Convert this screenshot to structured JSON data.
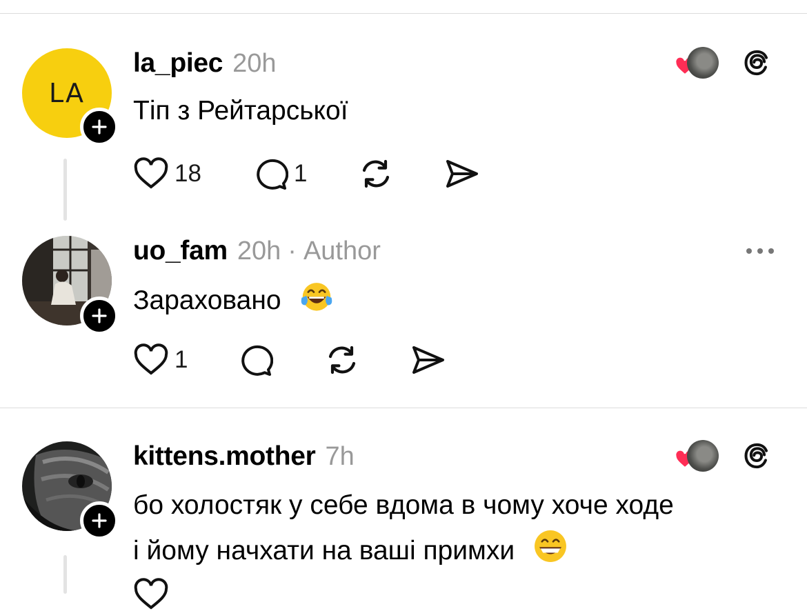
{
  "posts": [
    {
      "avatar_initials": "LA",
      "username": "la_piec",
      "time": "20h",
      "text": "Тіп з Рейтарської",
      "likes": "18",
      "replies": "1",
      "top_icons": [
        "liked-by-author-avatar",
        "threads-logo-icon"
      ]
    },
    {
      "username": "uo_fam",
      "time": "20h",
      "separator": "·",
      "author_tag": "Author",
      "text": "Зараховано",
      "emoji": "face-with-tears-of-joy",
      "likes": "1",
      "replies": ""
    },
    {
      "username": "kittens.mother",
      "time": "7h",
      "text_lines": [
        "бо холостяк у себе вдома в чому хоче ходе",
        "і йому начхати на ваші примхи"
      ],
      "emoji": "grinning-face-with-smiling-eyes",
      "top_icons": [
        "liked-by-author-avatar",
        "threads-logo-icon"
      ]
    }
  ],
  "colors": {
    "accent_heart": "#ff2d55",
    "avatar_yellow": "#f7cf0f",
    "meta_gray": "#999999",
    "divider": "#dcdcdc"
  }
}
